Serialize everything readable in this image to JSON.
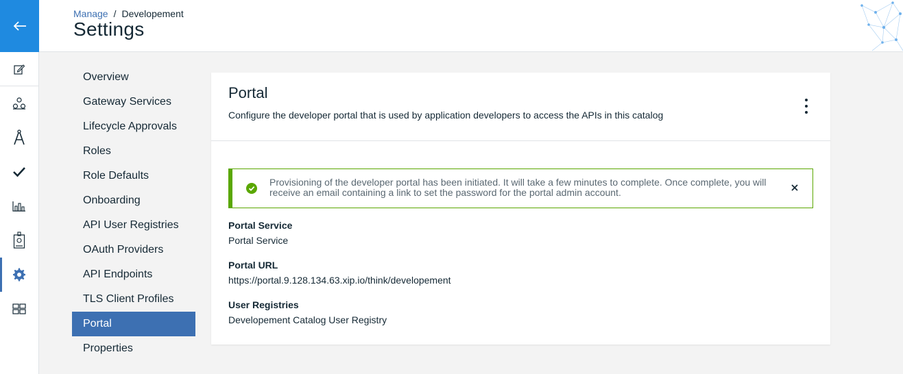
{
  "breadcrumb": {
    "parent": "Manage",
    "separator": "/",
    "current": "Developement"
  },
  "page": {
    "title": "Settings"
  },
  "rail": {
    "items": [
      {
        "icon": "edit-icon"
      },
      {
        "icon": "hierarchy-icon"
      },
      {
        "icon": "compass-icon"
      },
      {
        "icon": "checkmark-icon"
      },
      {
        "icon": "bar-chart-icon"
      },
      {
        "icon": "badge-icon"
      },
      {
        "icon": "gear-icon",
        "active": true
      },
      {
        "icon": "dashboard-icon"
      }
    ]
  },
  "sidenav": {
    "items": [
      {
        "label": "Overview"
      },
      {
        "label": "Gateway Services"
      },
      {
        "label": "Lifecycle Approvals"
      },
      {
        "label": "Roles"
      },
      {
        "label": "Role Defaults"
      },
      {
        "label": "Onboarding"
      },
      {
        "label": "API User Registries"
      },
      {
        "label": "OAuth Providers"
      },
      {
        "label": "API Endpoints"
      },
      {
        "label": "TLS Client Profiles"
      },
      {
        "label": "Portal",
        "active": true
      },
      {
        "label": "Properties"
      }
    ]
  },
  "card": {
    "title": "Portal",
    "description": "Configure the developer portal that is used by application developers to access the APIs in this catalog"
  },
  "notification": {
    "type": "success",
    "line1": "Provisioning of the developer portal has been initiated. It will take a few minutes to complete. Once complete, you will",
    "line2": "receive an email containing a link to set the password for the portal admin account."
  },
  "fields": {
    "portal_service": {
      "label": "Portal Service",
      "value": "Portal Service"
    },
    "portal_url": {
      "label": "Portal URL",
      "value": "https://portal.9.128.134.63.xip.io/think/developement"
    },
    "user_registries": {
      "label": "User Registries",
      "value": "Developement Catalog User Registry"
    }
  },
  "colors": {
    "primary": "#3d70b2",
    "back": "#1f8ae0",
    "success": "#5aa700"
  }
}
